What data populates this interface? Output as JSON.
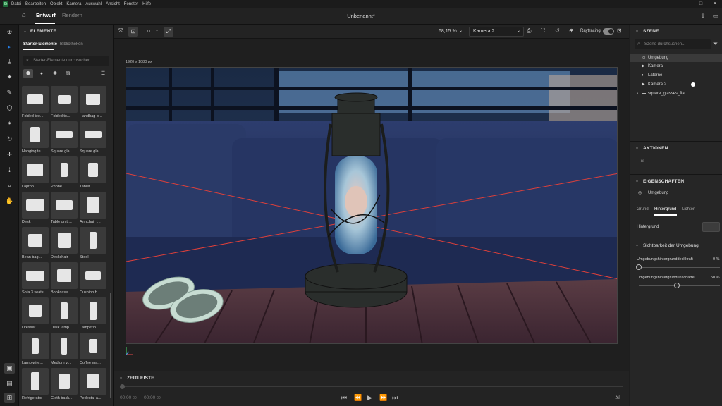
{
  "menubar": {
    "items": [
      "Datei",
      "Bearbeiten",
      "Objekt",
      "Kamera",
      "Auswahl",
      "Ansicht",
      "Fenster",
      "Hilfe"
    ],
    "logo": "St"
  },
  "header": {
    "tabs": [
      {
        "label": "Entwurf"
      },
      {
        "label": "Rendern"
      }
    ],
    "doc_title": "Unbenannt*"
  },
  "assets": {
    "section_title": "ELEMENTE",
    "tabs": [
      "Starter-Elemente",
      "Bibliotheken"
    ],
    "search_placeholder": "Starter-Elemente durchsuchen...",
    "items": [
      "Folded tee...",
      "Folded to...",
      "Handbag b...",
      "Hanging te...",
      "Square gla...",
      "Square gla...",
      "Laptop",
      "Phone",
      "Tablet",
      "Desk",
      "Table on tr...",
      "Armchair f...",
      "Bean bag...",
      "Deckchair",
      "Stool",
      "Sofa 3 seats",
      "Bookcase ...",
      "Cushion b...",
      "Dresser",
      "Desk lamp",
      "Lamp trip...",
      "Lamp wire...",
      "Medium v...",
      "Coffee ma...",
      "Refrigerator",
      "Cloth back...",
      "Pedestal a..."
    ]
  },
  "toolbar": {
    "zoom": "68,15 %",
    "camera": "Kamera 2",
    "raytracing_label": "Raytracing"
  },
  "viewport": {
    "size_label": "1920 x 1080 px"
  },
  "timeline": {
    "title": "ZEITLEISTE",
    "time_current": "00:00",
    "time_current_frames": "00",
    "time_total": "00:00",
    "time_total_frames": "00"
  },
  "scene": {
    "title": "SZENE",
    "search_placeholder": "Szene durchsuchen...",
    "items": [
      "Umgebung",
      "Kamera",
      "Laterne",
      "Kamera 2",
      "square_glasses_flat"
    ]
  },
  "actions": {
    "title": "AKTIONEN"
  },
  "properties": {
    "title": "EIGENSCHAFTEN",
    "selected": "Umgebung",
    "tabs": [
      "Grund",
      "Hintergrund",
      "Lichter"
    ],
    "bg_label": "Hintergrund",
    "visibility_title": "Sichtbarkeit der Umgebung",
    "slider1_label": "Umgebungshintergrunddeckkraft",
    "slider1_value": "0 %",
    "slider1_level": 0,
    "slider2_label": "Umgebungshintergrundunschärfe",
    "slider2_value": "50 %",
    "slider2_level": 0.5
  },
  "colors": {
    "accent": "#2680eb",
    "selection": "#3a3a3a",
    "raytrace_toggle": "#8a8a8a",
    "guide_lines": "#e0403a"
  }
}
